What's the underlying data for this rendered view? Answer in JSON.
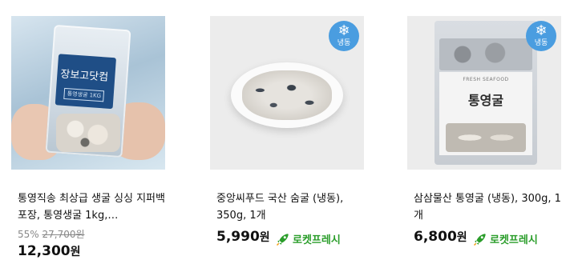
{
  "products": [
    {
      "title": "통영직송 최상급 생굴 싱싱 지퍼백 포장, 통영생굴 1kg,…",
      "discount": "55%",
      "original_price": "27,700원",
      "price": "12,300",
      "currency": "원",
      "package_brand": "장보고닷컴",
      "package_label": "통영생굴 1KG"
    },
    {
      "title": "중앙씨푸드 국산 숨굴 (냉동), 350g, 1개",
      "price": "5,990",
      "currency": "원",
      "badge": "냉동",
      "delivery": "로켓프레시"
    },
    {
      "title": "삼삼물산 통영굴 (냉동), 300g, 1개",
      "price": "6,800",
      "currency": "원",
      "badge": "냉동",
      "delivery": "로켓프레시",
      "package_tag": "FRESH SEAFOOD",
      "package_name": "통영굴"
    }
  ],
  "colors": {
    "frozen_badge": "#4a9de0",
    "rocket_fresh": "#2a9d2a",
    "old_price": "#888888"
  },
  "icons": {
    "frozen": "snowflake-icon",
    "delivery": "rocket-icon"
  }
}
